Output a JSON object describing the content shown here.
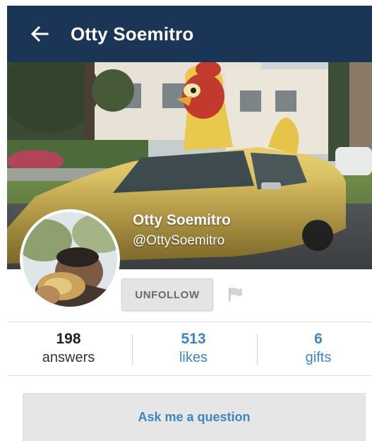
{
  "header": {
    "title": "Otty Soemitro",
    "back_icon": "arrow-left-icon"
  },
  "profile": {
    "name": "Otty Soemitro",
    "handle": "@OttySoemitro",
    "unfollow_label": "UNFOLLOW",
    "flag_icon": "flag-icon",
    "next_icon": "chevron-right-icon"
  },
  "stats": {
    "answers": {
      "count": "198",
      "label": "answers"
    },
    "likes": {
      "count": "513",
      "label": "likes"
    },
    "gifts": {
      "count": "6",
      "label": "gifts"
    }
  },
  "ask": {
    "label": "Ask me a question"
  },
  "colors": {
    "appbar": "#1b3557",
    "accent": "#3d86c6",
    "button_bg": "#e4e4e4"
  }
}
